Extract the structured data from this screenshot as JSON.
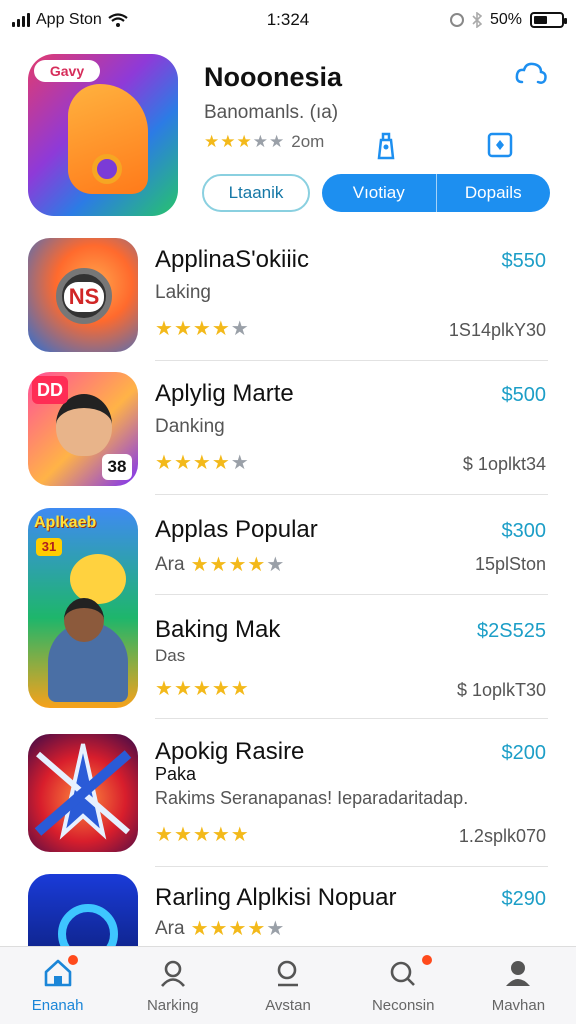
{
  "status_bar": {
    "carrier": "App Ston",
    "time": "1:324",
    "battery_text": "50%",
    "battery_level": 0.5
  },
  "featured": {
    "icon_badge": "Gavy",
    "title": "Nooonesia",
    "subtitle": "Banomanls. (ıa)",
    "rating_text": "2om",
    "rating_stars": 3,
    "button_outline": "Ltaanik",
    "segment_left": "Vıotiay",
    "segment_right": "Dopails"
  },
  "apps": [
    {
      "title": "ApplinaS'okiiic",
      "subtitle": "Laking",
      "price": "$550",
      "stars": 4,
      "count": "1S14plkY30",
      "icon_text": "NS"
    },
    {
      "title": "Aplylig Marte",
      "subtitle": "Danking",
      "price": "$500",
      "stars": 4,
      "count": "$ 1oplkt34",
      "icon_text": "DD",
      "icon_num": "38"
    },
    {
      "title": "Applas Popular",
      "subtitle": "Ara",
      "price": "$300",
      "stars": 4,
      "count": "15plSton",
      "icon_text": "Aplkaeb",
      "icon_chip": "31"
    },
    {
      "title": "Baking Mak",
      "subtitle": "Das",
      "price": "$2S525",
      "stars": 5,
      "count": "$ 1oplkT30"
    },
    {
      "title": "Apokig Rasire",
      "subtitle": "Paka",
      "description": "Rakims Seranapanas! Ieparadaritadap.",
      "price": "$200",
      "stars": 5,
      "count": "1.2splk070"
    },
    {
      "title": "Rarling Alplkisi Nopuar",
      "subtitle": "Ara",
      "price": "$290",
      "stars": 4,
      "count": ""
    }
  ],
  "nav": [
    {
      "label": "Enanah",
      "icon": "home-icon"
    },
    {
      "label": "Narking",
      "icon": "person-icon"
    },
    {
      "label": "Avstan",
      "icon": "search-icon"
    },
    {
      "label": "Neconsin",
      "icon": "search-badge-icon"
    },
    {
      "label": "Mavhan",
      "icon": "profile-icon"
    }
  ],
  "colors": {
    "accent": "#1d8ff0",
    "price": "#1c9ec7",
    "star": "#f3b91a",
    "badge_dot": "#ff4a1c"
  }
}
